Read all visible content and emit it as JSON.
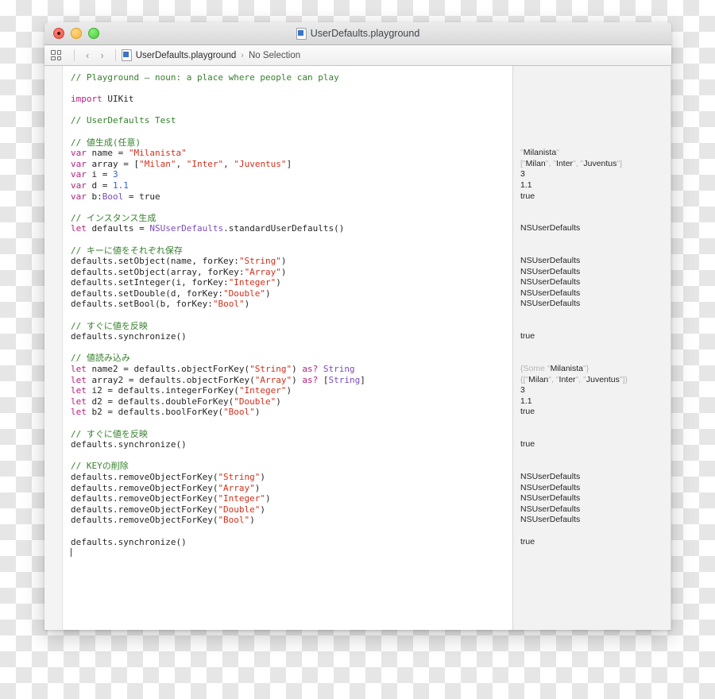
{
  "window": {
    "title": "UserDefaults.playground",
    "title_icon": "playground-document-icon",
    "traffic_lights": [
      "close-red",
      "minimize-yellow",
      "zoom-green"
    ]
  },
  "toolbar": {
    "navigator_toggle_icon": "grid-squares-icon",
    "back_label": "‹",
    "forward_label": "›",
    "jump_bar": {
      "file_icon": "playground-document-icon",
      "file_label": "UserDefaults.playground",
      "separator": "›",
      "selection_label": "No Selection"
    }
  },
  "colors": {
    "comment": "#36802d",
    "keyword": "#b5207f",
    "string": "#d12f1b",
    "number": "#2f5fd0",
    "type": "#7a4bbd",
    "plain": "#262626",
    "results_bg": "#f2f2f2",
    "editor_bg": "#ffffff"
  },
  "editor": {
    "language": "Swift",
    "lines": [
      [
        {
          "t": "// Playground — noun: a place where people can play",
          "c": "cmt"
        }
      ],
      [],
      [
        {
          "t": "import",
          "c": "kw"
        },
        {
          "t": " ",
          "c": "plain"
        },
        {
          "t": "UIKit",
          "c": "plain"
        }
      ],
      [],
      [
        {
          "t": "// UserDefaults Test",
          "c": "cmt"
        }
      ],
      [],
      [
        {
          "t": "// 値生成(任意)",
          "c": "cmt"
        }
      ],
      [
        {
          "t": "var",
          "c": "kw"
        },
        {
          "t": " name = ",
          "c": "plain"
        },
        {
          "t": "\"Milanista\"",
          "c": "str"
        }
      ],
      [
        {
          "t": "var",
          "c": "kw"
        },
        {
          "t": " array = [",
          "c": "plain"
        },
        {
          "t": "\"Milan\"",
          "c": "str"
        },
        {
          "t": ", ",
          "c": "plain"
        },
        {
          "t": "\"Inter\"",
          "c": "str"
        },
        {
          "t": ", ",
          "c": "plain"
        },
        {
          "t": "\"Juventus\"",
          "c": "str"
        },
        {
          "t": "]",
          "c": "plain"
        }
      ],
      [
        {
          "t": "var",
          "c": "kw"
        },
        {
          "t": " i = ",
          "c": "plain"
        },
        {
          "t": "3",
          "c": "num"
        }
      ],
      [
        {
          "t": "var",
          "c": "kw"
        },
        {
          "t": " d = ",
          "c": "plain"
        },
        {
          "t": "1.1",
          "c": "num"
        }
      ],
      [
        {
          "t": "var",
          "c": "kw"
        },
        {
          "t": " b:",
          "c": "plain"
        },
        {
          "t": "Bool",
          "c": "type"
        },
        {
          "t": " = ",
          "c": "plain"
        },
        {
          "t": "true",
          "c": "plain"
        }
      ],
      [],
      [
        {
          "t": "// インスタンス生成",
          "c": "cmt"
        }
      ],
      [
        {
          "t": "let",
          "c": "kw"
        },
        {
          "t": " defaults = ",
          "c": "plain"
        },
        {
          "t": "NSUserDefaults",
          "c": "type"
        },
        {
          "t": ".standardUserDefaults()",
          "c": "plain"
        }
      ],
      [],
      [
        {
          "t": "// キーに値をそれぞれ保存",
          "c": "cmt"
        }
      ],
      [
        {
          "t": "defaults",
          "c": "plain"
        },
        {
          "t": ".setObject(name, forKey:",
          "c": "plain"
        },
        {
          "t": "\"String\"",
          "c": "str"
        },
        {
          "t": ")",
          "c": "plain"
        }
      ],
      [
        {
          "t": "defaults",
          "c": "plain"
        },
        {
          "t": ".setObject(array, forKey:",
          "c": "plain"
        },
        {
          "t": "\"Array\"",
          "c": "str"
        },
        {
          "t": ")",
          "c": "plain"
        }
      ],
      [
        {
          "t": "defaults",
          "c": "plain"
        },
        {
          "t": ".setInteger(i, forKey:",
          "c": "plain"
        },
        {
          "t": "\"Integer\"",
          "c": "str"
        },
        {
          "t": ")",
          "c": "plain"
        }
      ],
      [
        {
          "t": "defaults",
          "c": "plain"
        },
        {
          "t": ".setDouble(d, forKey:",
          "c": "plain"
        },
        {
          "t": "\"Double\"",
          "c": "str"
        },
        {
          "t": ")",
          "c": "plain"
        }
      ],
      [
        {
          "t": "defaults",
          "c": "plain"
        },
        {
          "t": ".setBool(b, forKey:",
          "c": "plain"
        },
        {
          "t": "\"Bool\"",
          "c": "str"
        },
        {
          "t": ")",
          "c": "plain"
        }
      ],
      [],
      [
        {
          "t": "// すぐに値を反映",
          "c": "cmt"
        }
      ],
      [
        {
          "t": "defaults",
          "c": "plain"
        },
        {
          "t": ".synchronize()",
          "c": "plain"
        }
      ],
      [],
      [
        {
          "t": "// 値読み込み",
          "c": "cmt"
        }
      ],
      [
        {
          "t": "let",
          "c": "kw"
        },
        {
          "t": " name2 = defaults.objectForKey(",
          "c": "plain"
        },
        {
          "t": "\"String\"",
          "c": "str"
        },
        {
          "t": ") ",
          "c": "plain"
        },
        {
          "t": "as?",
          "c": "kw"
        },
        {
          "t": " ",
          "c": "plain"
        },
        {
          "t": "String",
          "c": "type"
        }
      ],
      [
        {
          "t": "let",
          "c": "kw"
        },
        {
          "t": " array2 = defaults.objectForKey(",
          "c": "plain"
        },
        {
          "t": "\"Array\"",
          "c": "str"
        },
        {
          "t": ") ",
          "c": "plain"
        },
        {
          "t": "as?",
          "c": "kw"
        },
        {
          "t": " [",
          "c": "plain"
        },
        {
          "t": "String",
          "c": "type"
        },
        {
          "t": "]",
          "c": "plain"
        }
      ],
      [
        {
          "t": "let",
          "c": "kw"
        },
        {
          "t": " i2 = defaults.integerForKey(",
          "c": "plain"
        },
        {
          "t": "\"Integer\"",
          "c": "str"
        },
        {
          "t": ")",
          "c": "plain"
        }
      ],
      [
        {
          "t": "let",
          "c": "kw"
        },
        {
          "t": " d2 = defaults.doubleForKey(",
          "c": "plain"
        },
        {
          "t": "\"Double\"",
          "c": "str"
        },
        {
          "t": ")",
          "c": "plain"
        }
      ],
      [
        {
          "t": "let",
          "c": "kw"
        },
        {
          "t": " b2 = defaults.boolForKey(",
          "c": "plain"
        },
        {
          "t": "\"Bool\"",
          "c": "str"
        },
        {
          "t": ")",
          "c": "plain"
        }
      ],
      [],
      [
        {
          "t": "// すぐに値を反映",
          "c": "cmt"
        }
      ],
      [
        {
          "t": "defaults",
          "c": "plain"
        },
        {
          "t": ".synchronize()",
          "c": "plain"
        }
      ],
      [],
      [
        {
          "t": "// KEYの削除",
          "c": "cmt"
        }
      ],
      [
        {
          "t": "defaults",
          "c": "plain"
        },
        {
          "t": ".removeObjectForKey(",
          "c": "plain"
        },
        {
          "t": "\"String\"",
          "c": "str"
        },
        {
          "t": ")",
          "c": "plain"
        }
      ],
      [
        {
          "t": "defaults",
          "c": "plain"
        },
        {
          "t": ".removeObjectForKey(",
          "c": "plain"
        },
        {
          "t": "\"Array\"",
          "c": "str"
        },
        {
          "t": ")",
          "c": "plain"
        }
      ],
      [
        {
          "t": "defaults",
          "c": "plain"
        },
        {
          "t": ".removeObjectForKey(",
          "c": "plain"
        },
        {
          "t": "\"Integer\"",
          "c": "str"
        },
        {
          "t": ")",
          "c": "plain"
        }
      ],
      [
        {
          "t": "defaults",
          "c": "plain"
        },
        {
          "t": ".removeObjectForKey(",
          "c": "plain"
        },
        {
          "t": "\"Double\"",
          "c": "str"
        },
        {
          "t": ")",
          "c": "plain"
        }
      ],
      [
        {
          "t": "defaults",
          "c": "plain"
        },
        {
          "t": ".removeObjectForKey(",
          "c": "plain"
        },
        {
          "t": "\"Bool\"",
          "c": "str"
        },
        {
          "t": ")",
          "c": "plain"
        }
      ],
      [],
      [
        {
          "t": "defaults",
          "c": "plain"
        },
        {
          "t": ".synchronize()",
          "c": "plain"
        }
      ],
      [
        {
          "t": "▏",
          "c": "caret"
        }
      ]
    ]
  },
  "results": {
    "lines": [
      [],
      [],
      [],
      [],
      [],
      [],
      [],
      [
        {
          "t": "\"",
          "c": "dim"
        },
        {
          "t": "Milanista",
          "c": "plain"
        },
        {
          "t": "\"",
          "c": "dim"
        }
      ],
      [
        {
          "t": "[\"",
          "c": "dim"
        },
        {
          "t": "Milan",
          "c": "plain"
        },
        {
          "t": "\", \"",
          "c": "dim"
        },
        {
          "t": "Inter",
          "c": "plain"
        },
        {
          "t": "\", \"",
          "c": "dim"
        },
        {
          "t": "Juventus",
          "c": "plain"
        },
        {
          "t": "\"]",
          "c": "dim"
        }
      ],
      [
        {
          "t": "3",
          "c": "plain"
        }
      ],
      [
        {
          "t": "1.1",
          "c": "plain"
        }
      ],
      [
        {
          "t": "true",
          "c": "plain"
        }
      ],
      [],
      [],
      [
        {
          "t": "NSUserDefaults",
          "c": "plain"
        }
      ],
      [],
      [],
      [
        {
          "t": "NSUserDefaults",
          "c": "plain"
        }
      ],
      [
        {
          "t": "NSUserDefaults",
          "c": "plain"
        }
      ],
      [
        {
          "t": "NSUserDefaults",
          "c": "plain"
        }
      ],
      [
        {
          "t": "NSUserDefaults",
          "c": "plain"
        }
      ],
      [
        {
          "t": "NSUserDefaults",
          "c": "plain"
        }
      ],
      [],
      [],
      [
        {
          "t": "true",
          "c": "plain"
        }
      ],
      [],
      [],
      [
        {
          "t": "{Some ",
          "c": "dim"
        },
        {
          "t": "\"",
          "c": "dim"
        },
        {
          "t": "Milanista",
          "c": "plain"
        },
        {
          "t": "\"}",
          "c": "dim"
        }
      ],
      [
        {
          "t": "{[\"",
          "c": "dim"
        },
        {
          "t": "Milan",
          "c": "plain"
        },
        {
          "t": "\", \"",
          "c": "dim"
        },
        {
          "t": "Inter",
          "c": "plain"
        },
        {
          "t": "\", \"",
          "c": "dim"
        },
        {
          "t": "Juventus",
          "c": "plain"
        },
        {
          "t": "\"]}",
          "c": "dim"
        }
      ],
      [
        {
          "t": "3",
          "c": "plain"
        }
      ],
      [
        {
          "t": "1.1",
          "c": "plain"
        }
      ],
      [
        {
          "t": "true",
          "c": "plain"
        }
      ],
      [],
      [],
      [
        {
          "t": "true",
          "c": "plain"
        }
      ],
      [],
      [],
      [
        {
          "t": "NSUserDefaults",
          "c": "plain"
        }
      ],
      [
        {
          "t": "NSUserDefaults",
          "c": "plain"
        }
      ],
      [
        {
          "t": "NSUserDefaults",
          "c": "plain"
        }
      ],
      [
        {
          "t": "NSUserDefaults",
          "c": "plain"
        }
      ],
      [
        {
          "t": "NSUserDefaults",
          "c": "plain"
        }
      ],
      [],
      [
        {
          "t": "true",
          "c": "plain"
        }
      ],
      []
    ]
  }
}
